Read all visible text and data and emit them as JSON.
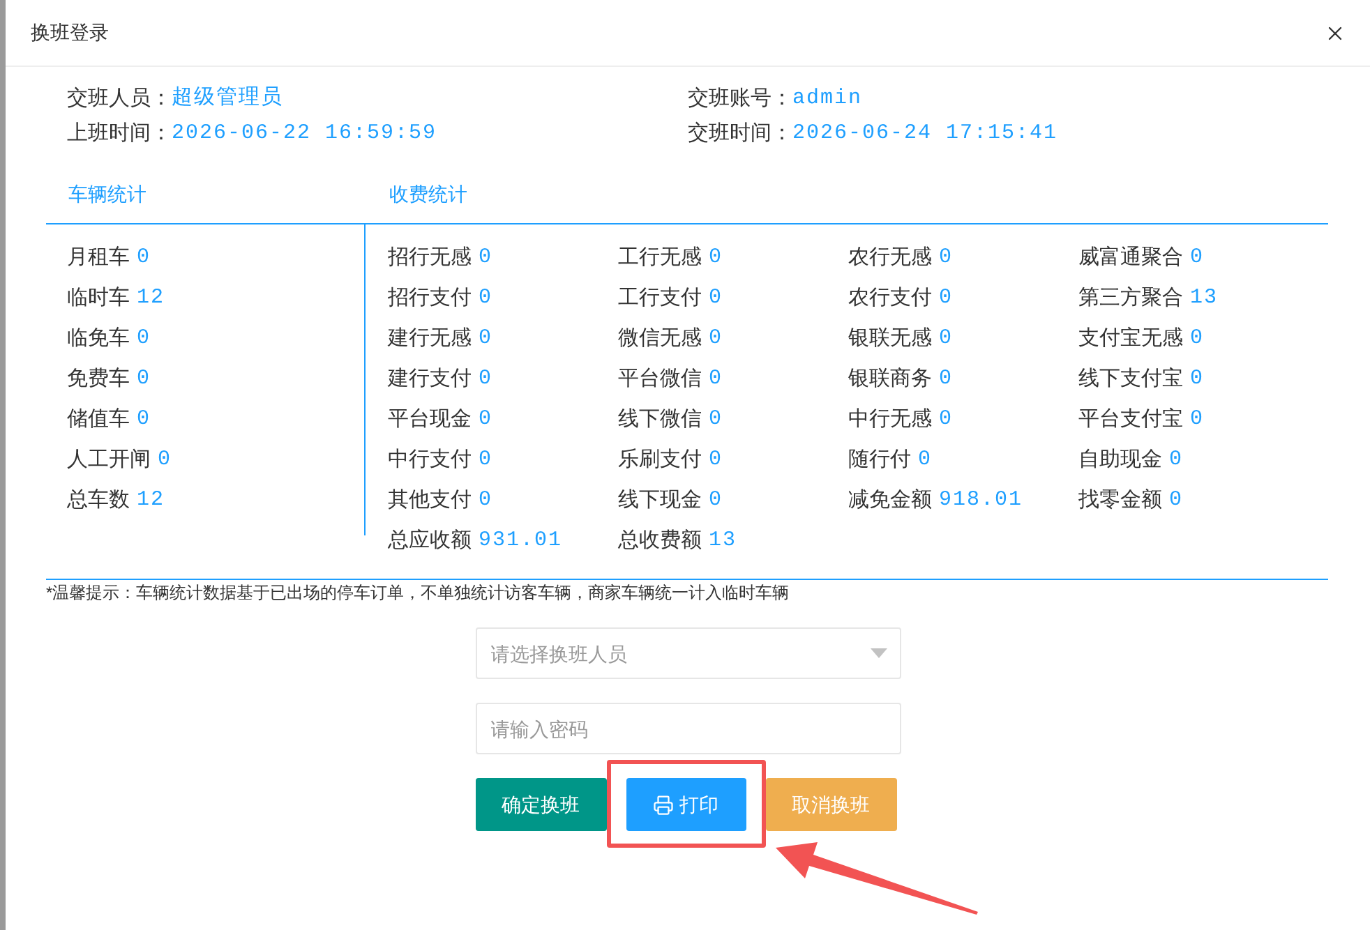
{
  "window": {
    "title": "换班登录"
  },
  "shift_info": [
    {
      "label": "交班人员：",
      "value": "超级管理员"
    },
    {
      "label": "交班账号：",
      "value": "admin"
    },
    {
      "label": "上班时间：",
      "value": "2026-06-22 16:59:59"
    },
    {
      "label": "交班时间：",
      "value": "2026-06-24 17:15:41"
    }
  ],
  "vehicle_stats": {
    "title": "车辆统计",
    "items": [
      {
        "label": "月租车",
        "value": "0"
      },
      {
        "label": "临时车",
        "value": "12"
      },
      {
        "label": "临免车",
        "value": "0"
      },
      {
        "label": "免费车",
        "value": "0"
      },
      {
        "label": "储值车",
        "value": "0"
      },
      {
        "label": "人工开闸",
        "value": "0"
      },
      {
        "label": "总车数",
        "value": "12"
      }
    ]
  },
  "fee_stats": {
    "title": "收费统计",
    "items": [
      {
        "label": "招行无感",
        "value": "0"
      },
      {
        "label": "工行无感",
        "value": "0"
      },
      {
        "label": "农行无感",
        "value": "0"
      },
      {
        "label": "威富通聚合",
        "value": "0"
      },
      {
        "label": "招行支付",
        "value": "0"
      },
      {
        "label": "工行支付",
        "value": "0"
      },
      {
        "label": "农行支付",
        "value": "0"
      },
      {
        "label": "第三方聚合",
        "value": "13"
      },
      {
        "label": "建行无感",
        "value": "0"
      },
      {
        "label": "微信无感",
        "value": "0"
      },
      {
        "label": "银联无感",
        "value": "0"
      },
      {
        "label": "支付宝无感",
        "value": "0"
      },
      {
        "label": "建行支付",
        "value": "0"
      },
      {
        "label": "平台微信",
        "value": "0"
      },
      {
        "label": "银联商务",
        "value": "0"
      },
      {
        "label": "线下支付宝",
        "value": "0"
      },
      {
        "label": "平台现金",
        "value": "0"
      },
      {
        "label": "线下微信",
        "value": "0"
      },
      {
        "label": "中行无感",
        "value": "0"
      },
      {
        "label": "平台支付宝",
        "value": "0"
      },
      {
        "label": "中行支付",
        "value": "0"
      },
      {
        "label": "乐刷支付",
        "value": "0"
      },
      {
        "label": "随行付",
        "value": "0"
      },
      {
        "label": "自助现金",
        "value": "0"
      },
      {
        "label": "其他支付",
        "value": "0"
      },
      {
        "label": "线下现金",
        "value": "0"
      },
      {
        "label": "减免金额",
        "value": "918.01"
      },
      {
        "label": "找零金额",
        "value": "0"
      },
      {
        "label": "总应收额",
        "value": "931.01"
      },
      {
        "label": "总收费额",
        "value": "13"
      }
    ]
  },
  "tip": "*温馨提示：车辆统计数据基于已出场的停车订单，不单独统计访客车辆，商家车辆统一计入临时车辆",
  "form": {
    "staff_select": {
      "placeholder": "请选择换班人员"
    },
    "password": {
      "placeholder": "请输入密码"
    }
  },
  "buttons": [
    {
      "kind": "confirm",
      "label": "确定换班"
    },
    {
      "kind": "print",
      "label": "打印"
    },
    {
      "kind": "cancel",
      "label": "取消换班"
    }
  ]
}
